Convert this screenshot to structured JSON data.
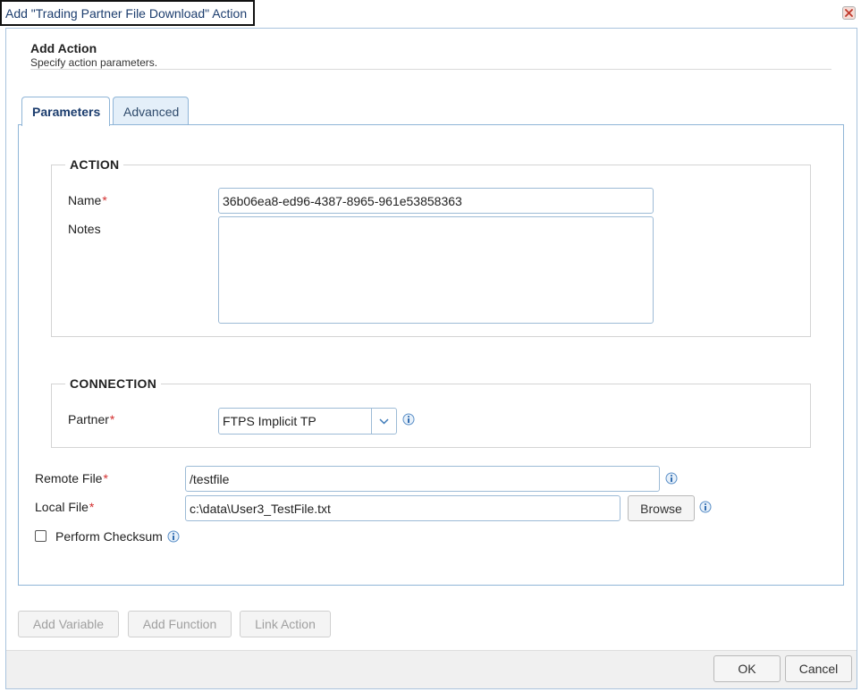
{
  "window": {
    "title": "Add \"Trading Partner File Download\" Action"
  },
  "header": {
    "title": "Add Action",
    "subtitle": "Specify action parameters."
  },
  "tabs": [
    {
      "label": "Parameters",
      "active": true
    },
    {
      "label": "Advanced",
      "active": false
    }
  ],
  "action_section": {
    "legend": "ACTION",
    "name_label": "Name",
    "name_value": "36b06ea8-ed96-4387-8965-961e53858363",
    "notes_label": "Notes",
    "notes_value": ""
  },
  "connection_section": {
    "legend": "CONNECTION",
    "partner_label": "Partner",
    "partner_value": "FTPS Implicit TP"
  },
  "files": {
    "remote_label": "Remote File",
    "remote_value": "/testfile",
    "local_label": "Local File",
    "local_value": "c:\\data\\User3_TestFile.txt",
    "browse_label": "Browse",
    "checksum_label": "Perform Checksum",
    "checksum_checked": false
  },
  "required_marker": "*",
  "bottom_buttons": {
    "add_variable": "Add Variable",
    "add_function": "Add Function",
    "link_action": "Link Action"
  },
  "footer": {
    "ok": "OK",
    "cancel": "Cancel"
  },
  "colors": {
    "accent_border": "#8fb5d7",
    "required": "#d32f2f",
    "title_text": "#1c3d6e"
  }
}
